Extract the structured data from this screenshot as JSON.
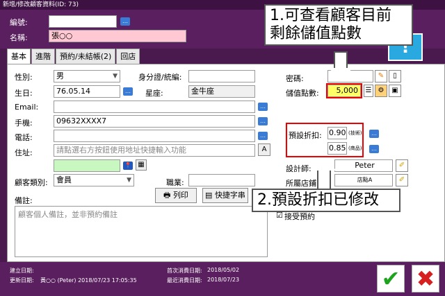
{
  "window": {
    "title": "新增/修改顧客資料(ID: 73)"
  },
  "header": {
    "code_label": "編號:",
    "code_value": "",
    "name_label": "名稱:",
    "name_value": "張○○"
  },
  "tabs": [
    {
      "label": "基本"
    },
    {
      "label": "進階"
    },
    {
      "label": "預約/未結帳(2)"
    },
    {
      "label": "回店"
    }
  ],
  "form": {
    "gender_label": "性別:",
    "gender_value": "男",
    "id_label": "身分證/統編:",
    "id_value": "",
    "birthday_label": "生日:",
    "birthday_value": "76.05.14",
    "zodiac_label": "星座:",
    "zodiac_value": "金牛座",
    "email_label": "Email:",
    "email_value": "",
    "mobile_label": "手機:",
    "mobile_value": "09632XXXX7",
    "phone_label": "電話:",
    "phone_value": "",
    "address_label": "住址:",
    "address_placeholder": "請點選右方按鈕使用地址快捷輸入功能",
    "category_label": "顧客類別:",
    "category_value": "會員",
    "job_label": "職業:",
    "job_value": "",
    "note_label": "備註:",
    "note_placeholder": "顧客個人備註，並非預約備註",
    "print_button": "列印",
    "quick_button": "快捷字串",
    "password_label": "密碼:",
    "password_value": "",
    "points_label": "儲值點數:",
    "points_value": "5,000",
    "discount_label": "預設折扣:",
    "discount_tech": "0.90",
    "discount_tech_tag": "(技術)",
    "discount_product": "0.85",
    "discount_product_tag": "(商品)",
    "designer_label": "設計師:",
    "designer_value": "Peter",
    "store_label": "所屬店鋪:",
    "store_value": "店點A",
    "accept_label": "接受預約"
  },
  "annotations": {
    "callout1": "1.可查看顧客目前\n剩餘儲值點數",
    "callout2": "2.預設折扣已修改"
  },
  "footer": {
    "created_label": "建立日期:",
    "created_value": "",
    "updated_label": "更新日期:",
    "updated_value": "黃○○ (Peter) 2018/07/23 17:05:35",
    "first_label": "首次消費日期:",
    "first_value": "2018/05/02",
    "last_label": "最近消費日期:",
    "last_value": "2018/07/23"
  },
  "colors": {
    "accent": "#5a1f5e",
    "highlight": "#ff0000",
    "points_bg": "#ffff66"
  },
  "icons": [
    "pencil-icon",
    "document-icon",
    "list-icon",
    "gear-icon",
    "ellipsis-icon",
    "chat-icon",
    "pin-icon",
    "map-icon",
    "brush-icon",
    "printer-icon",
    "check-icon",
    "cross-icon"
  ]
}
